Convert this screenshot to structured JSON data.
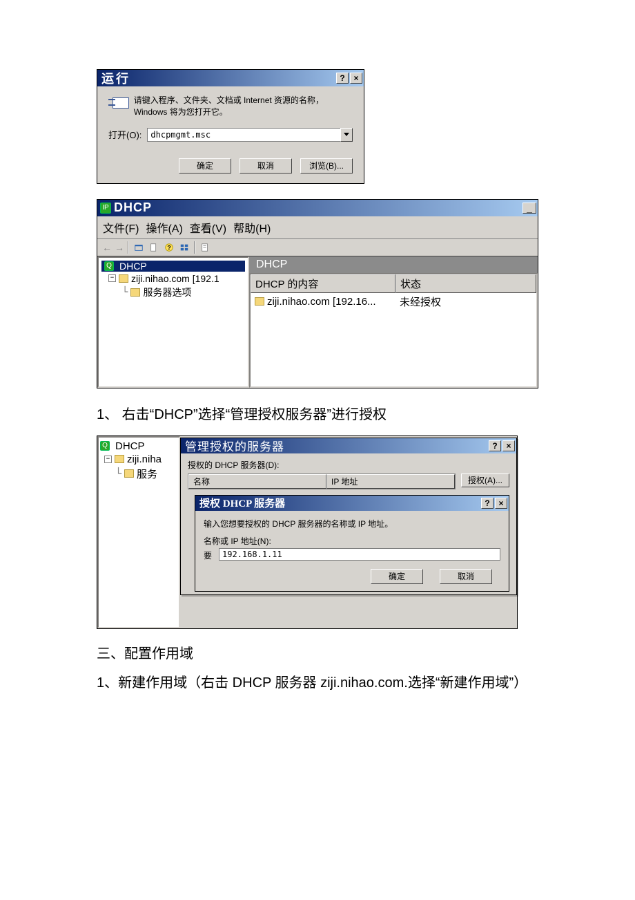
{
  "run_dialog": {
    "title": "运行",
    "help_glyph": "?",
    "close_glyph": "×",
    "msg": "请键入程序、文件夹、文档或 Internet 资源的名称，Windows 将为您打开它。",
    "open_label": "打开(O):",
    "open_value": "dhcpmgmt.msc",
    "ok": "确定",
    "cancel": "取消",
    "browse": "浏览(B)..."
  },
  "mmc": {
    "title": "DHCP",
    "menus": {
      "file": "文件(F)",
      "action": "操作(A)",
      "view": "查看(V)",
      "help": "帮助(H)"
    },
    "tree": {
      "root": "DHCP",
      "server": "ziji.nihao.com [192.1",
      "server_options": "服务器选项"
    },
    "pane_header": "DHCP",
    "columns": {
      "content": "DHCP 的内容",
      "status": "状态"
    },
    "row": {
      "name": "ziji.nihao.com [192.16...",
      "status": "未经授权"
    }
  },
  "instruction1": "1、 右击“DHCP”选择“管理授权服务器”进行授权",
  "mmc2": {
    "tree": {
      "root": "DHCP",
      "server": "ziji.niha",
      "options": "服务"
    }
  },
  "auth_dialog": {
    "title": "管理授权的服务器",
    "list_label": "授权的 DHCP 服务器(D):",
    "col_name": "名称",
    "col_ip": "IP 地址",
    "authorize_btn": "授权(A)...",
    "side_label": "要"
  },
  "sub_dialog": {
    "title": "授权 DHCP 服务器",
    "msg": "输入您想要授权的 DHCP 服务器的名称或 IP 地址。",
    "label": "名称或 IP 地址(N):",
    "value": "192.168.1.11",
    "ok": "确定",
    "cancel": "取消"
  },
  "heading3": "三、配置作用域",
  "instruction3_1": "1、新建作用域（右击 DHCP 服务器 ziji.nihao.com.选择“新建作用域”）"
}
